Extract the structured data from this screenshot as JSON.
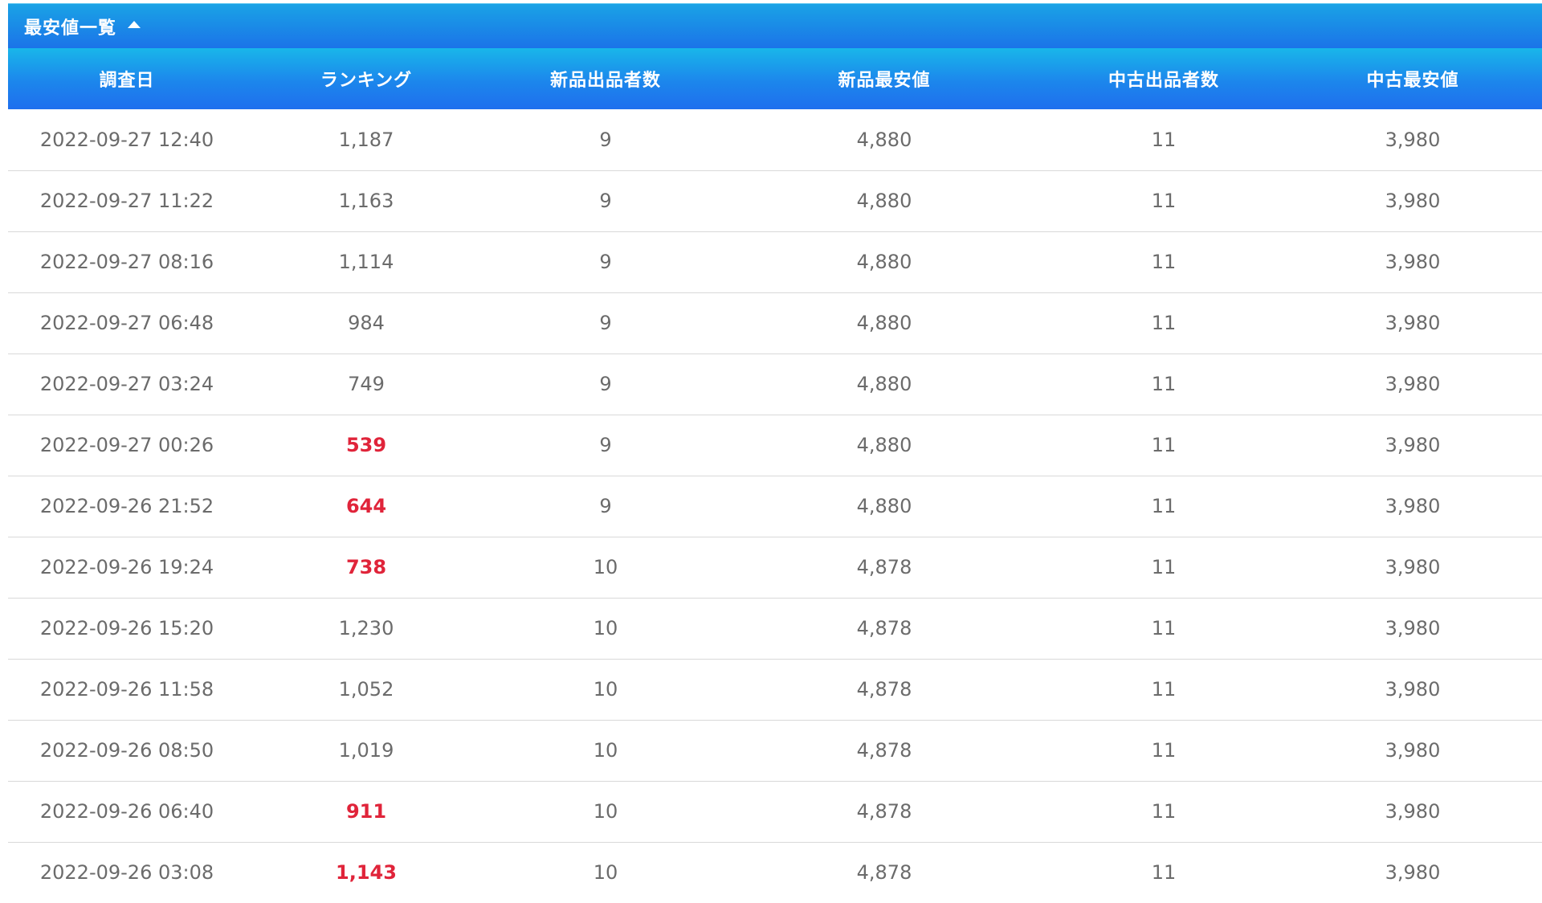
{
  "panel": {
    "title": "最安値一覧",
    "caret_icon": "caret-up-icon",
    "header_gradient_top": "#19b6ea",
    "header_gradient_bottom": "#1f6fee",
    "alert_color": "#e0243a"
  },
  "table": {
    "columns": [
      "調査日",
      "ランキング",
      "新品出品者数",
      "新品最安値",
      "中古出品者数",
      "中古最安値"
    ],
    "rows": [
      {
        "date": "2022-09-27 12:40",
        "ranking": "1,187",
        "ranking_alert": false,
        "new_sellers": "9",
        "new_lowest": "4,880",
        "used_sellers": "11",
        "used_lowest": "3,980"
      },
      {
        "date": "2022-09-27 11:22",
        "ranking": "1,163",
        "ranking_alert": false,
        "new_sellers": "9",
        "new_lowest": "4,880",
        "used_sellers": "11",
        "used_lowest": "3,980"
      },
      {
        "date": "2022-09-27 08:16",
        "ranking": "1,114",
        "ranking_alert": false,
        "new_sellers": "9",
        "new_lowest": "4,880",
        "used_sellers": "11",
        "used_lowest": "3,980"
      },
      {
        "date": "2022-09-27 06:48",
        "ranking": "984",
        "ranking_alert": false,
        "new_sellers": "9",
        "new_lowest": "4,880",
        "used_sellers": "11",
        "used_lowest": "3,980"
      },
      {
        "date": "2022-09-27 03:24",
        "ranking": "749",
        "ranking_alert": false,
        "new_sellers": "9",
        "new_lowest": "4,880",
        "used_sellers": "11",
        "used_lowest": "3,980"
      },
      {
        "date": "2022-09-27 00:26",
        "ranking": "539",
        "ranking_alert": true,
        "new_sellers": "9",
        "new_lowest": "4,880",
        "used_sellers": "11",
        "used_lowest": "3,980"
      },
      {
        "date": "2022-09-26 21:52",
        "ranking": "644",
        "ranking_alert": true,
        "new_sellers": "9",
        "new_lowest": "4,880",
        "used_sellers": "11",
        "used_lowest": "3,980"
      },
      {
        "date": "2022-09-26 19:24",
        "ranking": "738",
        "ranking_alert": true,
        "new_sellers": "10",
        "new_lowest": "4,878",
        "used_sellers": "11",
        "used_lowest": "3,980"
      },
      {
        "date": "2022-09-26 15:20",
        "ranking": "1,230",
        "ranking_alert": false,
        "new_sellers": "10",
        "new_lowest": "4,878",
        "used_sellers": "11",
        "used_lowest": "3,980"
      },
      {
        "date": "2022-09-26 11:58",
        "ranking": "1,052",
        "ranking_alert": false,
        "new_sellers": "10",
        "new_lowest": "4,878",
        "used_sellers": "11",
        "used_lowest": "3,980"
      },
      {
        "date": "2022-09-26 08:50",
        "ranking": "1,019",
        "ranking_alert": false,
        "new_sellers": "10",
        "new_lowest": "4,878",
        "used_sellers": "11",
        "used_lowest": "3,980"
      },
      {
        "date": "2022-09-26 06:40",
        "ranking": "911",
        "ranking_alert": true,
        "new_sellers": "10",
        "new_lowest": "4,878",
        "used_sellers": "11",
        "used_lowest": "3,980"
      },
      {
        "date": "2022-09-26 03:08",
        "ranking": "1,143",
        "ranking_alert": true,
        "new_sellers": "10",
        "new_lowest": "4,878",
        "used_sellers": "11",
        "used_lowest": "3,980"
      }
    ]
  }
}
